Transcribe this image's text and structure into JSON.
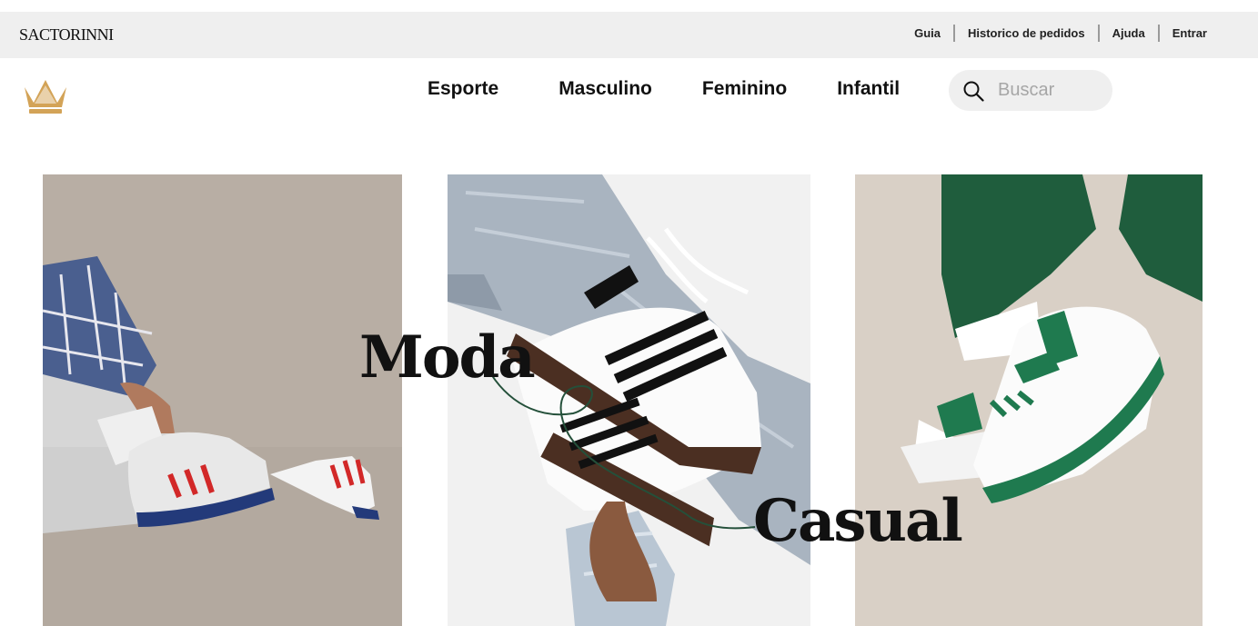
{
  "header": {
    "brand": "SACTORINNI",
    "util_links": [
      "Guia",
      "Historico de pedidos",
      "Ajuda",
      "Entrar"
    ]
  },
  "nav": {
    "items": [
      "Esporte",
      "Masculino",
      "Feminino",
      "Infantil"
    ]
  },
  "search": {
    "placeholder": "Buscar",
    "value": ""
  },
  "hero": {
    "word1": "Moda",
    "word2": "Casual"
  },
  "colors": {
    "crown": "#d3a357",
    "topbar_bg": "#efefef",
    "accent_green": "#1f6b47"
  },
  "icons": [
    "crown-logo-icon",
    "search-icon"
  ]
}
